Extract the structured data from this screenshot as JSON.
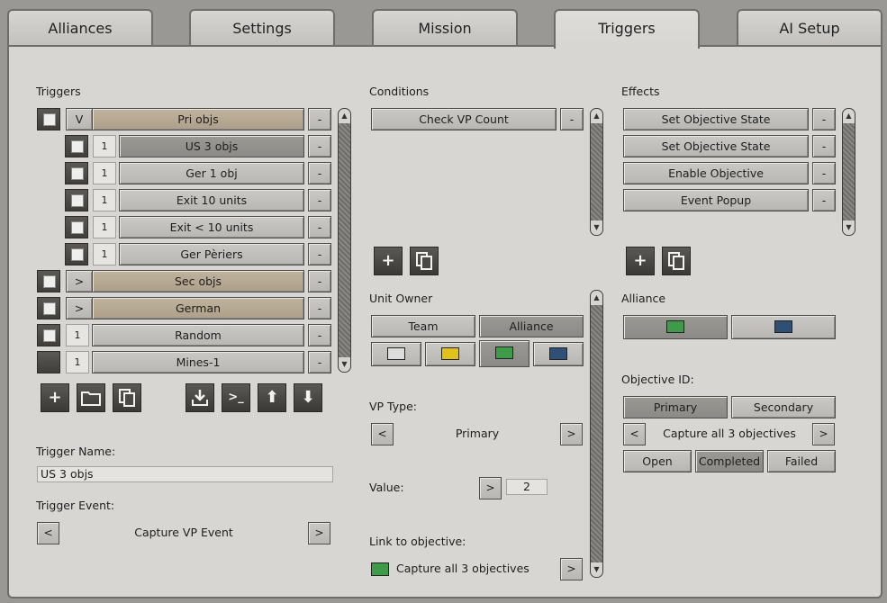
{
  "tabs": [
    {
      "label": "Alliances"
    },
    {
      "label": "Settings"
    },
    {
      "label": "Mission"
    },
    {
      "label": "Triggers"
    },
    {
      "label": "AI Setup"
    }
  ],
  "triggers": {
    "title": "Triggers",
    "rows": [
      {
        "toggle": "V",
        "label": "Pri objs",
        "remove": "-"
      },
      {
        "count": "1",
        "label": "US 3 objs",
        "remove": "-"
      },
      {
        "count": "1",
        "label": "Ger 1 obj",
        "remove": "-"
      },
      {
        "count": "1",
        "label": "Exit 10 units",
        "remove": "-"
      },
      {
        "count": "1",
        "label": "Exit < 10 units",
        "remove": "-"
      },
      {
        "count": "1",
        "label": "Ger Pèriers",
        "remove": "-"
      },
      {
        "toggle": ">",
        "label": "Sec objs",
        "remove": "-"
      },
      {
        "toggle": ">",
        "label": "German",
        "remove": "-"
      },
      {
        "count": "1",
        "label": "Random",
        "remove": "-"
      },
      {
        "count": "1",
        "label": "Mines-1",
        "remove": "-"
      }
    ],
    "name_label": "Trigger Name:",
    "name_value": "US 3 objs",
    "event_label": "Trigger Event:",
    "event_value": "Capture VP Event",
    "prev": "<",
    "next": ">"
  },
  "conditions": {
    "title": "Conditions",
    "items": [
      {
        "label": "Check VP Count",
        "remove": "-"
      }
    ],
    "unit_owner_label": "Unit Owner",
    "owner_team": "Team",
    "owner_alliance": "Alliance",
    "vp_type_label": "VP Type:",
    "vp_type_value": "Primary",
    "value_label": "Value:",
    "value": "2",
    "link_label": "Link to objective:",
    "link_value": "Capture all 3 objectives",
    "prev": "<",
    "next": ">"
  },
  "effects": {
    "title": "Effects",
    "items": [
      {
        "label": "Set Objective State",
        "remove": "-"
      },
      {
        "label": "Set Objective State",
        "remove": "-"
      },
      {
        "label": "Enable Objective",
        "remove": "-"
      },
      {
        "label": "Event Popup",
        "remove": "-"
      }
    ],
    "alliance_label": "Alliance",
    "objective_id_label": "Objective ID:",
    "primary": "Primary",
    "secondary": "Secondary",
    "objective_value": "Capture all 3 objectives",
    "state_open": "Open",
    "state_completed": "Completed",
    "state_failed": "Failed",
    "prev": "<",
    "next": ">"
  },
  "colors": {
    "white": "#dcdcdc",
    "yellow": "#e0c21a",
    "green": "#3f9a4a",
    "blue": "#2f4f74"
  },
  "icons": {
    "add": "+",
    "up": "⬆",
    "down": "⬇"
  }
}
